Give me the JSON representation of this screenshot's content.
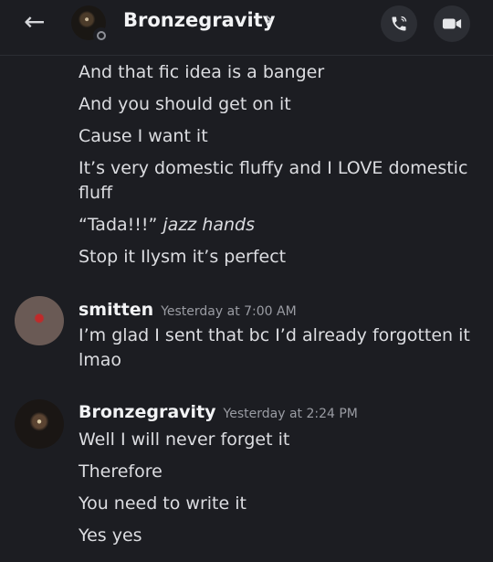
{
  "header": {
    "back_icon": "arrow-left-icon",
    "title": "Bronzegravity",
    "chevron": "›",
    "call_icon": "phone-icon",
    "video_icon": "video-camera-icon"
  },
  "messages_top": [
    "And that fic idea is a banger",
    "And you should get on it",
    "Cause I want it",
    "It’s very domestic fluffy and I LOVE domestic fluff",
    "Stop it Ilysm it’s perfect"
  ],
  "tada": {
    "quote": "“Tada!!!”",
    "italic": "jazz hands"
  },
  "smitten": {
    "author": "smitten",
    "timestamp": "Yesterday at 7:00 AM",
    "text": "I’m glad I sent that bc I’d already forgotten it lmao"
  },
  "bronze": {
    "author": "Bronzegravity",
    "timestamp": "Yesterday at 2:24 PM",
    "lines": [
      "Well I will never forget it",
      "Therefore",
      "You need to write it",
      "Yes yes"
    ]
  }
}
